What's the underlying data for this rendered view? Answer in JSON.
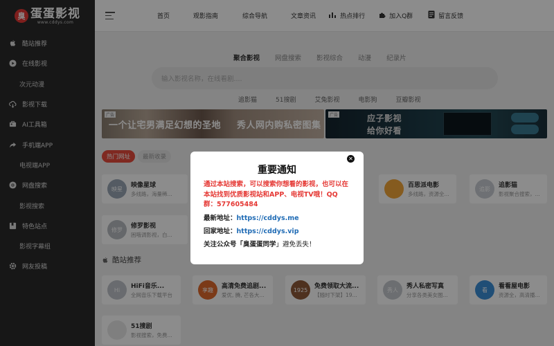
{
  "logo": {
    "badge": "臭",
    "name": "蛋蛋影视",
    "url": "www.cddys.com"
  },
  "sidebar": {
    "items": [
      {
        "label": "酷站推荐",
        "icon": "apple-icon",
        "sub": false
      },
      {
        "label": "在线影视",
        "icon": "play-circle-icon",
        "sub": false
      },
      {
        "label": "次元动漫",
        "icon": "",
        "sub": true
      },
      {
        "label": "影视下载",
        "icon": "cloud-download-icon",
        "sub": false
      },
      {
        "label": "AI工具箱",
        "icon": "toolbox-icon",
        "sub": false
      },
      {
        "label": "手机端APP",
        "icon": "share-arrow-icon",
        "sub": false
      },
      {
        "label": "电视端APP",
        "icon": "",
        "sub": true
      },
      {
        "label": "网盘搜索",
        "icon": "chrome-icon",
        "sub": false
      },
      {
        "label": "影视搜索",
        "icon": "",
        "sub": true
      },
      {
        "label": "特色站点",
        "icon": "bookmark-icon",
        "sub": false
      },
      {
        "label": "影视字幕组",
        "icon": "",
        "sub": true
      },
      {
        "label": "网友投稿",
        "icon": "cog-icon",
        "sub": false
      }
    ]
  },
  "header": {
    "nav": [
      {
        "label": "首页"
      },
      {
        "label": "观影指南"
      },
      {
        "label": "综合导航"
      },
      {
        "label": "文章资讯"
      },
      {
        "label": "热点排行",
        "icon": "bar-chart-icon"
      },
      {
        "label": "加入Q群",
        "icon": "puzzle-icon"
      },
      {
        "label": "留言反馈",
        "icon": "file-icon"
      }
    ]
  },
  "main": {
    "tabs": [
      "聚合影视",
      "网盘搜索",
      "影视综合",
      "动漫",
      "纪录片"
    ],
    "search_placeholder": "输入影视名称，在线看剧....",
    "sources": [
      "追影猫",
      "51搜剧",
      "艾兔影视",
      "电影狗",
      "豆瓣影视"
    ],
    "ads": {
      "tag": "广告",
      "ad1_left": "一个让宅男满足幻想的圣地",
      "ad1_right": "秀人网内购私密图集",
      "ad2_line1": "应子影视",
      "ad2_line2": "给你好看"
    },
    "pills": [
      "热门网址",
      "最新收录"
    ],
    "hot_cards": [
      {
        "name": "映像星球",
        "desc": "多线路，海量稀...",
        "color": "#9aa7b5",
        "thumb": "映星"
      },
      {
        "name": "百思派电影",
        "desc": "多线路，资源全...",
        "color": "#f2a63a",
        "thumb": ""
      },
      {
        "name": "追影猫",
        "desc": "影视聚合搜索，...",
        "color": "#c8cdd3",
        "thumb": "追影"
      },
      {
        "name": "修罗影视",
        "desc": "困哦调影视，白...",
        "color": "#b8bcc2",
        "thumb": "修罗"
      }
    ],
    "section_title": "酷站推荐",
    "cool_cards": [
      {
        "name": "HiFi音乐...",
        "desc": "全网音乐下载平台",
        "color": "#c0c4ca",
        "thumb": "Hi"
      },
      {
        "name": "高清免费追剧...",
        "desc": "爱优, 腾, 芒各大...",
        "color": "#e06a2c",
        "thumb": "享趣"
      },
      {
        "name": "免费领取大流...",
        "desc": "【随时下架】19...",
        "color": "#8f5a3a",
        "thumb": "1925"
      },
      {
        "name": "秀人私密写真",
        "desc": "分享各类美女图...",
        "color": "#c5c9ce",
        "thumb": "秀人"
      },
      {
        "name": "看看屋电影",
        "desc": "资源全，高清播...",
        "color": "#3b8ed8",
        "thumb": "看"
      },
      {
        "name": "51搜剧",
        "desc": "影视搜索，免费...",
        "color": "#e8e8e8",
        "thumb": ""
      }
    ]
  },
  "modal": {
    "title": "重要通知",
    "red_text": "通过本站搜索，可以搜索你想看的影视，也可以在本站找到优质影视站和APP、电视TV哦！QQ群：577605484",
    "latest_label": "最新地址：",
    "latest_url": "https://cddys.me",
    "home_label": "回家地址：",
    "home_url": "https://cddys.vip",
    "note_prefix": "关注公众号「",
    "note_name": "臭蛋蛋同学",
    "note_suffix": "」避免丢失！",
    "close_glyph": "✕"
  },
  "colors": {
    "accent": "#e74c3c",
    "link": "#1f6bb5",
    "sidebar": "#2b2b2b"
  }
}
